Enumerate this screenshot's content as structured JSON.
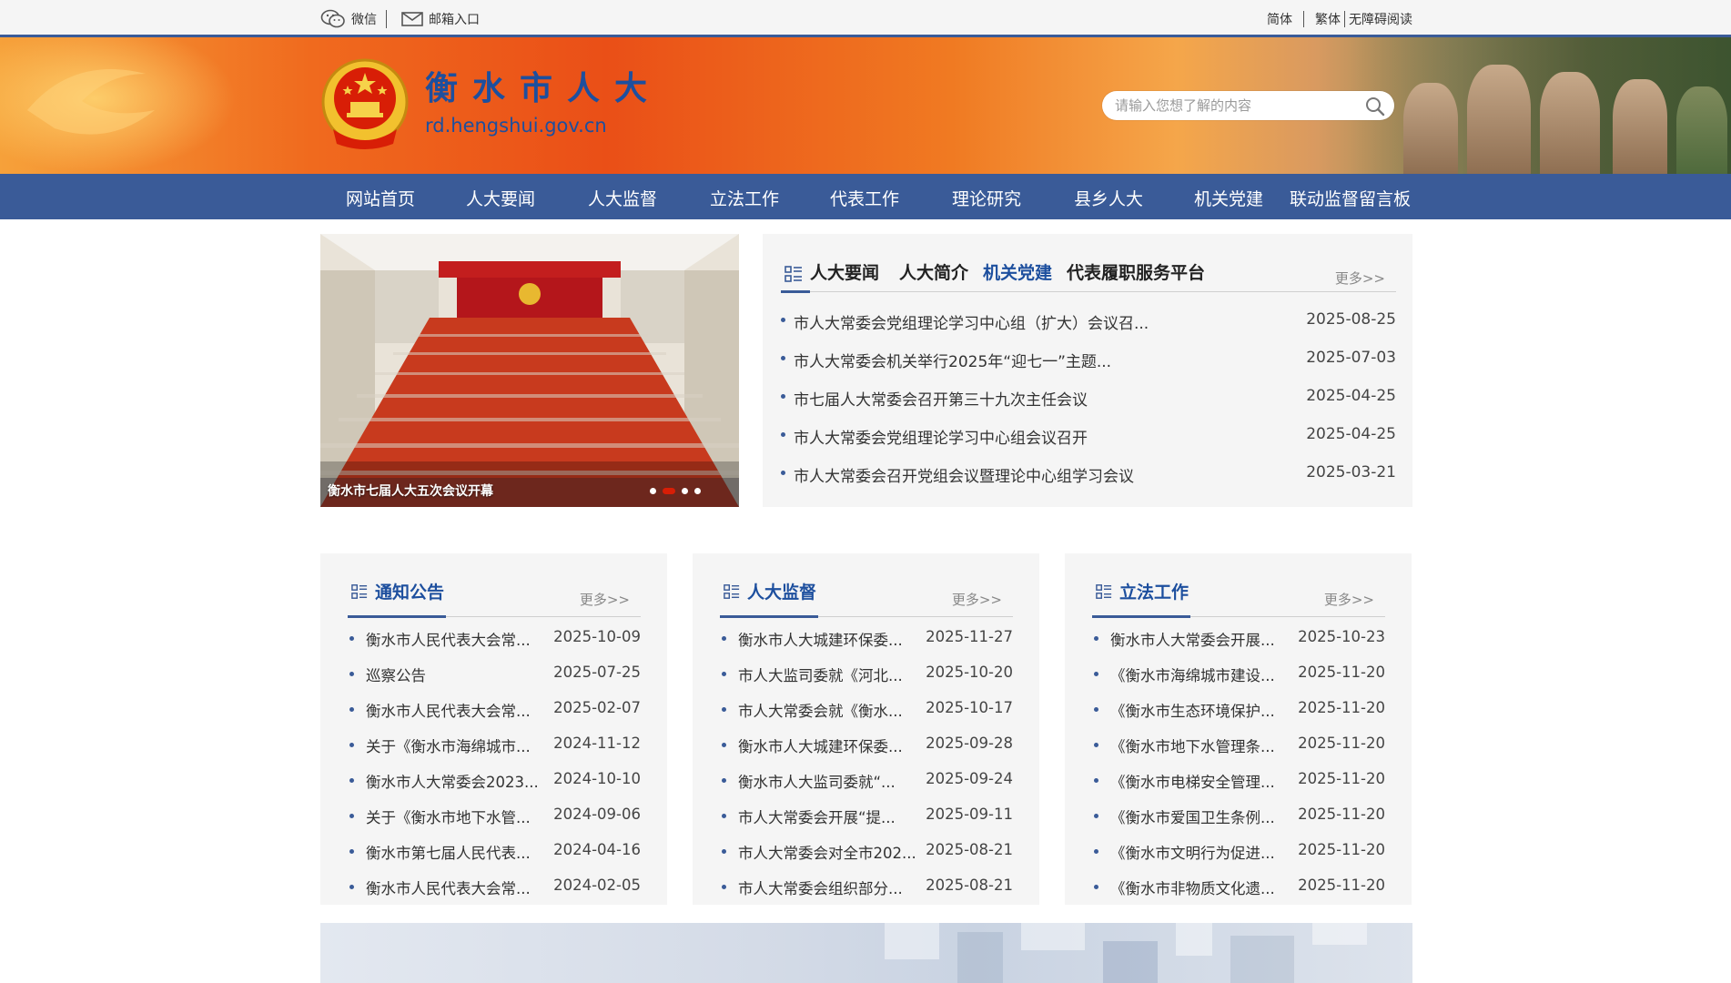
{
  "topbar": {
    "wechat_label": "微信",
    "mailbox_label": "邮箱入口",
    "simplified_label": "简体",
    "traditional_label": "繁体",
    "accessible_label": "无障碍阅读"
  },
  "header": {
    "site_title": "衡水市人大",
    "site_url": "rd.hengshui.gov.cn",
    "search_placeholder": "请输入您想了解的内容"
  },
  "nav": {
    "items": [
      {
        "label": "网站首页"
      },
      {
        "label": "人大要闻"
      },
      {
        "label": "人大监督"
      },
      {
        "label": "立法工作"
      },
      {
        "label": "代表工作"
      },
      {
        "label": "理论研究"
      },
      {
        "label": "县乡人大"
      },
      {
        "label": "机关党建"
      },
      {
        "label": "联动监督留言板"
      }
    ]
  },
  "carousel": {
    "caption": "衡水市七届人大五次会议开幕",
    "slide_count": 4,
    "active_slide": 2
  },
  "news_panel": {
    "tabs": [
      {
        "label": "人大要闻"
      },
      {
        "label": "人大简介"
      },
      {
        "label": "机关党建"
      },
      {
        "label": "代表履职服务平台"
      }
    ],
    "active_tab": "机关党建",
    "more_label": "更多>>",
    "items": [
      {
        "title": "市人大常委会党组理论学习中心组（扩大）会议召...",
        "date": "2025-08-25"
      },
      {
        "title": "市人大常委会机关举行2025年“迎七一”主题...",
        "date": "2025-07-03"
      },
      {
        "title": "市七届人大常委会召开第三十九次主任会议",
        "date": "2025-04-25"
      },
      {
        "title": "市人大常委会党组理论学习中心组会议召开",
        "date": "2025-04-25"
      },
      {
        "title": "市人大常委会召开党组会议暨理论中心组学习会议",
        "date": "2025-03-21"
      }
    ]
  },
  "columns": [
    {
      "title": "通知公告",
      "more_label": "更多>>",
      "items": [
        {
          "title": "衡水市人民代表大会常...",
          "date": "2025-10-09"
        },
        {
          "title": "巡察公告",
          "date": "2025-07-25"
        },
        {
          "title": "衡水市人民代表大会常...",
          "date": "2025-02-07"
        },
        {
          "title": "关于《衡水市海绵城市...",
          "date": "2024-11-12"
        },
        {
          "title": "衡水市人大常委会2023...",
          "date": "2024-10-10"
        },
        {
          "title": "关于《衡水市地下水管...",
          "date": "2024-09-06"
        },
        {
          "title": "衡水市第七届人民代表...",
          "date": "2024-04-16"
        },
        {
          "title": "衡水市人民代表大会常...",
          "date": "2024-02-05"
        }
      ]
    },
    {
      "title": "人大监督",
      "more_label": "更多>>",
      "items": [
        {
          "title": "衡水市人大城建环保委...",
          "date": "2025-11-27"
        },
        {
          "title": "市人大监司委就《河北...",
          "date": "2025-10-20"
        },
        {
          "title": "市人大常委会就《衡水...",
          "date": "2025-10-17"
        },
        {
          "title": "衡水市人大城建环保委...",
          "date": "2025-09-28"
        },
        {
          "title": "衡水市人大监司委就“...",
          "date": "2025-09-24"
        },
        {
          "title": "市人大常委会开展“提...",
          "date": "2025-09-11"
        },
        {
          "title": "市人大常委会对全市202...",
          "date": "2025-08-21"
        },
        {
          "title": "市人大常委会组织部分...",
          "date": "2025-08-21"
        }
      ]
    },
    {
      "title": "立法工作",
      "more_label": "更多>>",
      "items": [
        {
          "title": "衡水市人大常委会开展...",
          "date": "2025-10-23"
        },
        {
          "title": "《衡水市海绵城市建设...",
          "date": "2025-11-20"
        },
        {
          "title": "《衡水市生态环境保护...",
          "date": "2025-11-20"
        },
        {
          "title": "《衡水市地下水管理条...",
          "date": "2025-11-20"
        },
        {
          "title": "《衡水市电梯安全管理...",
          "date": "2025-11-20"
        },
        {
          "title": "《衡水市爱国卫生条例...",
          "date": "2025-11-20"
        },
        {
          "title": "《衡水市文明行为促进...",
          "date": "2025-11-20"
        },
        {
          "title": "《衡水市非物质文化遗...",
          "date": "2025-11-20"
        }
      ]
    }
  ],
  "colors": {
    "primary_blue": "#3a5b98",
    "title_blue": "#1d4f9e",
    "banner_orange": "#ea4f17",
    "carousel_active": "#d81e06"
  },
  "icons": [
    "wechat-icon",
    "mail-icon",
    "national-emblem-icon",
    "search-icon",
    "list-icon"
  ]
}
